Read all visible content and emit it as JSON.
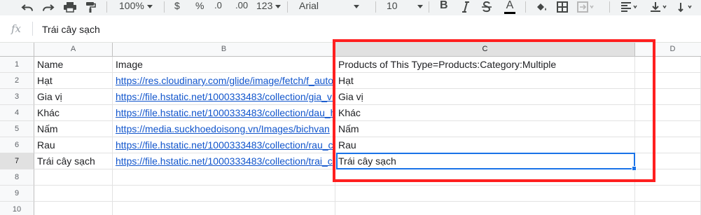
{
  "toolbar": {
    "zoom": "100%",
    "currency_symbol": "$",
    "percent_symbol": "%",
    "decrease_decimal": ".0",
    "increase_decimal": ".00",
    "more_formats": "123",
    "font_family": "Arial",
    "font_size": "10",
    "bold": "B",
    "text_color_letter": "A",
    "accent_color": "#444746"
  },
  "formula_bar": {
    "fx_label": "fx",
    "content": "Trái cây sạch"
  },
  "columns": [
    "A",
    "B",
    "C",
    "D"
  ],
  "rows": [
    "1",
    "2",
    "3",
    "4",
    "5",
    "6",
    "7",
    "8",
    "9",
    "10"
  ],
  "cells": {
    "a": [
      "Name",
      "Hạt",
      "Gia vị",
      "Khác",
      "Nấm",
      "Rau",
      "Trái cây sạch"
    ],
    "b": [
      "Image",
      "https://res.cloudinary.com/glide/image/fetch/f_auto",
      "https://file.hstatic.net/1000333483/collection/gia_vi",
      "https://file.hstatic.net/1000333483/collection/dau_h",
      "https://media.suckhoedoisong.vn/Images/bichvan",
      "https://file.hstatic.net/1000333483/collection/rau_c",
      "https://file.hstatic.net/1000333483/collection/trai_c"
    ],
    "c": [
      "Products of This Type=Products:Category:Multiple",
      "Hạt",
      "Gia vị",
      "Khác",
      "Nấm",
      "Rau",
      "Trái cây sạch"
    ]
  },
  "selection": {
    "active_cell": "C7",
    "highlight_color": "#ff1f1f",
    "selection_color": "#1a73e8",
    "link_color": "#1155cc"
  }
}
